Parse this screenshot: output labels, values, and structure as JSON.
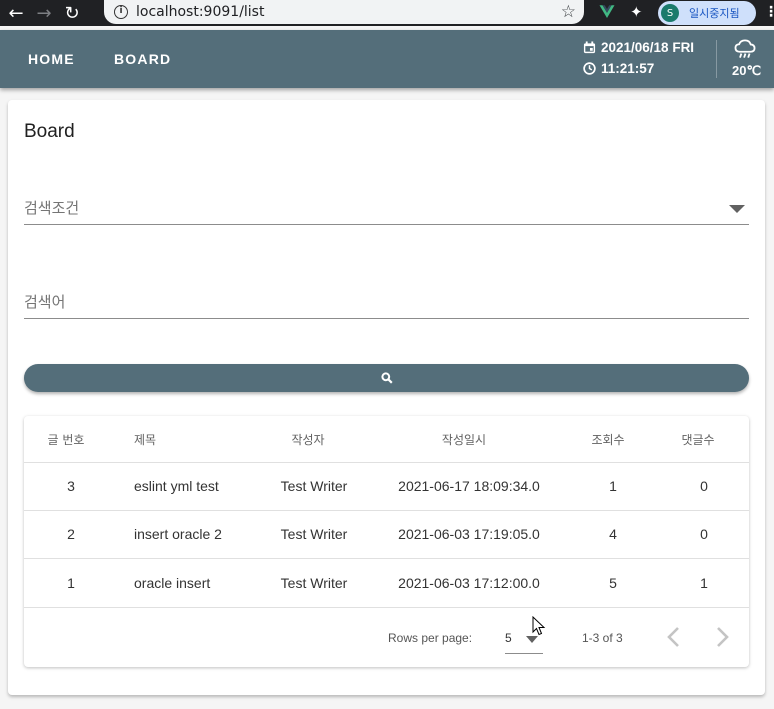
{
  "browser": {
    "url": "localhost:9091/list",
    "profile_initial": "S",
    "profile_label": "일시중지됨"
  },
  "appbar": {
    "nav": [
      "HOME",
      "BOARD"
    ],
    "date": "2021/06/18 FRI",
    "time": "11:21:57",
    "temperature": "20℃"
  },
  "board": {
    "title": "Board",
    "search_condition_label": "검색조건",
    "search_keyword_label": "검색어"
  },
  "table": {
    "headers": [
      "글 번호",
      "제목",
      "작성자",
      "작성일시",
      "조회수",
      "댓글수"
    ],
    "rows": [
      {
        "no": "3",
        "title": "eslint yml test",
        "writer": "Test Writer",
        "date": "2021-06-17 18:09:34.0",
        "views": "1",
        "comments": "0"
      },
      {
        "no": "2",
        "title": "insert oracle 2",
        "writer": "Test Writer",
        "date": "2021-06-03 17:19:05.0",
        "views": "4",
        "comments": "0"
      },
      {
        "no": "1",
        "title": "oracle insert",
        "writer": "Test Writer",
        "date": "2021-06-03 17:12:00.0",
        "views": "5",
        "comments": "1"
      }
    ],
    "footer": {
      "rows_per_page_label": "Rows per page:",
      "rows_per_page_value": "5",
      "range_text": "1-3 of 3"
    }
  },
  "icons": {
    "back": "arrow-left-icon",
    "forward": "arrow-right-icon",
    "reload": "reload-icon",
    "info": "info-icon",
    "star": "star-icon",
    "vue": "vue-devtools-icon",
    "extensions": "puzzle-icon",
    "calendar": "calendar-icon",
    "clock": "clock-icon",
    "weather": "cloud-rain-icon",
    "search": "magnifier-icon",
    "prev": "chevron-left-icon",
    "next": "chevron-right-icon"
  },
  "colors": {
    "primary": "#546e7a",
    "browser_bg": "#202124",
    "surface": "#ffffff"
  }
}
